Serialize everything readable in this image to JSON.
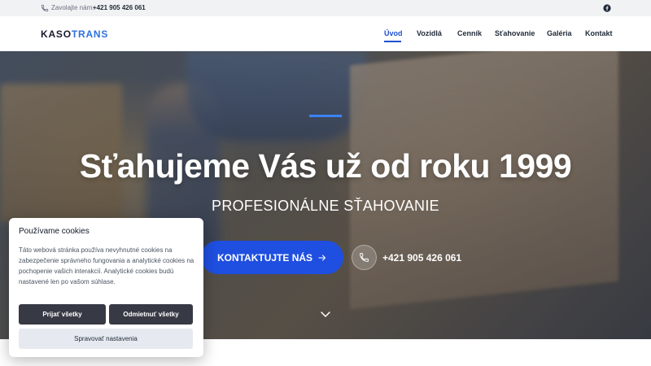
{
  "topbar": {
    "call_label": "Zavolajte nám:",
    "call_number": "+421 905 426 061",
    "social_icon": "facebook-icon"
  },
  "header": {
    "logo_part1": "KASO",
    "logo_part2": "TRANS",
    "nav": [
      {
        "label": "Úvod",
        "active": true
      },
      {
        "label": "Vozidlá"
      },
      {
        "label": "Cenník"
      },
      {
        "label": "Sťahovanie"
      },
      {
        "label": "Galéria"
      },
      {
        "label": "Kontakt"
      }
    ]
  },
  "hero": {
    "title": "Sťahujeme Vás už od roku 1999",
    "subtitle": "PROFESIONÁLNE SŤAHOVANIE",
    "cta_label": "KONTAKTUJTE NÁS",
    "phone": "+421 905 426 061"
  },
  "cookie": {
    "title": "Používame cookies",
    "text": "Táto webová stránka používa nevyhnutné cookies na zabezpečenie správneho fungovania a analytické cookies na pochopenie vašich interakcií. Analytické cookies budú nastavené len po vašom súhlase.",
    "accept_label": "Prijať všetky",
    "reject_label": "Odmietnuť všetky",
    "manage_label": "Spravovať nastavenia"
  },
  "colors": {
    "accent": "#1f4fe0",
    "brand_blue": "#2f6fe0",
    "dark_button": "#373a45"
  }
}
